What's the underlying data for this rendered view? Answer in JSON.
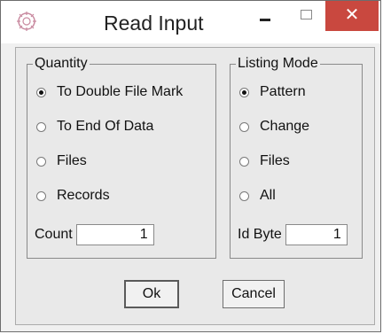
{
  "window": {
    "title": "Read Input",
    "close_label": "✕",
    "colors": {
      "close_bg": "#c9483f",
      "client_bg": "#e9e9e9"
    }
  },
  "quantity": {
    "legend": "Quantity",
    "options": [
      {
        "label": "To Double File Mark",
        "selected": true
      },
      {
        "label": "To End Of Data",
        "selected": false
      },
      {
        "label": "Files",
        "selected": false
      },
      {
        "label": "Records",
        "selected": false
      }
    ],
    "count_label": "Count",
    "count_value": "1"
  },
  "listing_mode": {
    "legend": "Listing Mode",
    "options": [
      {
        "label": "Pattern",
        "selected": true
      },
      {
        "label": "Change",
        "selected": false
      },
      {
        "label": "Files",
        "selected": false
      },
      {
        "label": "All",
        "selected": false
      }
    ],
    "id_byte_label": "Id Byte",
    "id_byte_value": "1"
  },
  "buttons": {
    "ok_label": "Ok",
    "cancel_label": "Cancel"
  }
}
